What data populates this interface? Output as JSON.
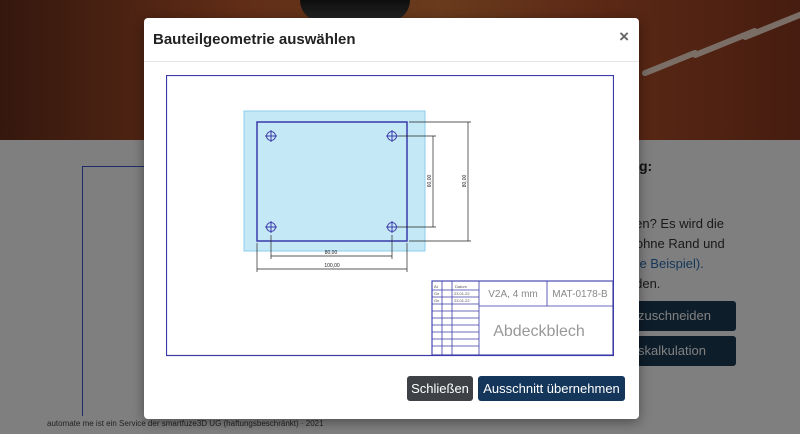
{
  "background": {
    "side_heading": "g:",
    "side_lines": [
      "iden? Es wird die",
      "e ohne Rand und"
    ],
    "side_link": "ehe Beispiel).",
    "side_line_last": "eiden.",
    "buttons": [
      "zuschneiden",
      "skalkulation"
    ],
    "footer": "automate me ist ein Service der smartfuze3D UG (haftungsbeschränkt) · 2021"
  },
  "modal": {
    "title": "Bauteilgeometrie auswählen",
    "close_symbol": "×",
    "buttons": {
      "close": "Schließen",
      "apply": "Ausschnitt übernehmen"
    }
  },
  "drawing": {
    "colors": {
      "line": "#3a3aa8",
      "highlight": "#bfe6f7"
    },
    "dimensions": {
      "bottom_inner": "80,00",
      "bottom_outer": "100,00",
      "right_inner": "60,00",
      "right_outer": "80,00"
    },
    "title_block": {
      "col_headers": [
        "Ät",
        "Datum"
      ],
      "rows": [
        [
          "Ge",
          "23.01.22"
        ],
        [
          "Ge",
          "23.01.22"
        ]
      ],
      "material": "V2A, 4 mm",
      "part_number": "MAT-0178-B",
      "part_name": "Abdeckblech"
    }
  }
}
